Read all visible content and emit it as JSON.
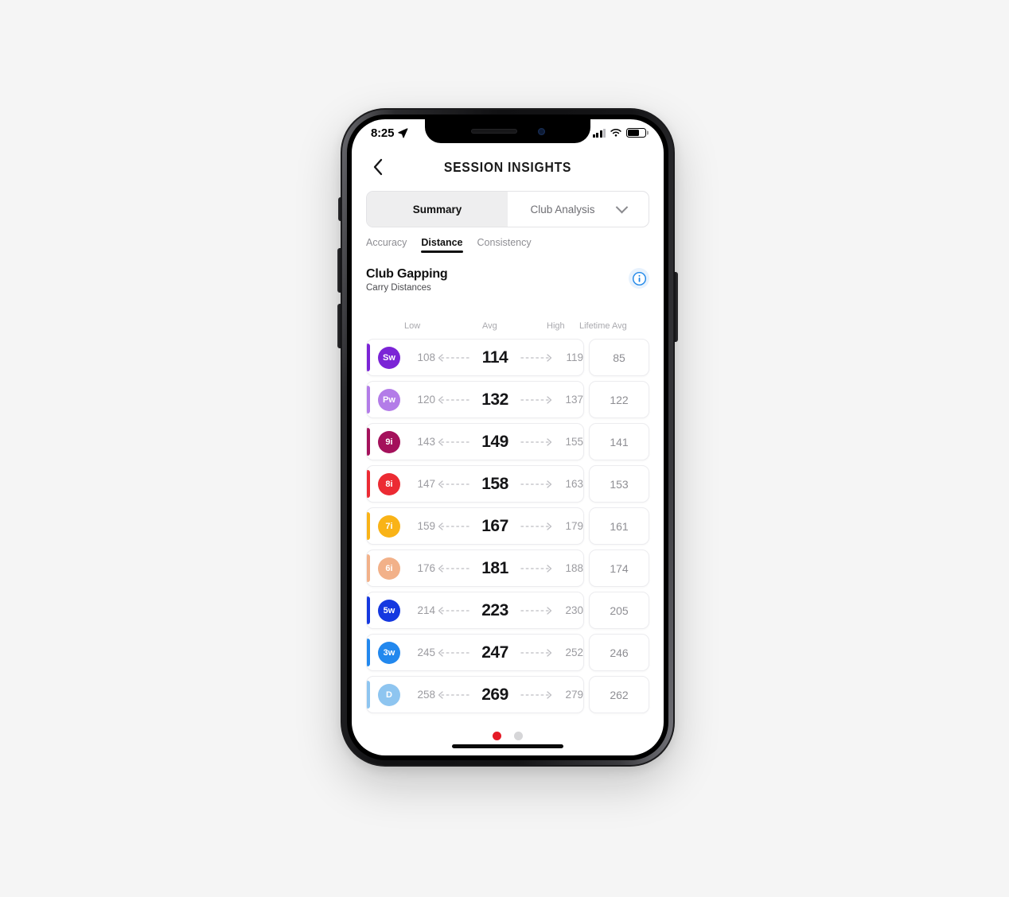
{
  "status_bar": {
    "time": "8:25",
    "location_icon": "location-arrow-icon",
    "signal_icon": "cellular-signal-icon",
    "wifi_icon": "wifi-icon",
    "battery_icon": "battery-icon"
  },
  "nav": {
    "back_icon": "chevron-left-icon",
    "title": "SESSION INSIGHTS"
  },
  "segmented_control": {
    "summary_label": "Summary",
    "club_analysis_label": "Club Analysis",
    "chevron_icon": "chevron-down-icon",
    "active": "Summary"
  },
  "sub_tabs": {
    "items": [
      {
        "label": "Accuracy",
        "active": false
      },
      {
        "label": "Distance",
        "active": true
      },
      {
        "label": "Consistency",
        "active": false
      }
    ]
  },
  "section": {
    "title": "Club Gapping",
    "subtitle": "Carry Distances",
    "info_icon": "info-circle-icon",
    "info_color": "#1f87e8"
  },
  "table": {
    "headers": {
      "low": "Low",
      "avg": "Avg",
      "high": "High",
      "lifetime": "Lifetime Avg"
    },
    "arrow_left_icon": "dashed-arrow-left-icon",
    "arrow_right_icon": "dashed-arrow-right-icon"
  },
  "pager": {
    "active_color": "#e51b27",
    "inactive_color": "#d6d6d8",
    "dots": 2,
    "active_index": 0
  },
  "home_indicator": "home-indicator-bar",
  "chart_data": {
    "type": "table",
    "title": "Club Gapping",
    "subtitle": "Carry Distances",
    "columns": [
      "Club",
      "Low",
      "Avg",
      "High",
      "Lifetime Avg"
    ],
    "unit": "yards",
    "rows": [
      {
        "club": "Sw",
        "low": "108",
        "avg": "114",
        "high": "119",
        "lifetime": "85",
        "color": "#7b24d6",
        "accent": "#7b24d6"
      },
      {
        "club": "Pw",
        "low": "120",
        "avg": "132",
        "high": "137",
        "lifetime": "122",
        "color": "#b37ce8",
        "accent": "#b37ce8"
      },
      {
        "club": "9i",
        "low": "143",
        "avg": "149",
        "high": "155",
        "lifetime": "141",
        "color": "#a4115b",
        "accent": "#a4115b"
      },
      {
        "club": "8i",
        "low": "147",
        "avg": "158",
        "high": "163",
        "lifetime": "153",
        "color": "#ec2b33",
        "accent": "#ec2b33"
      },
      {
        "club": "7i",
        "low": "159",
        "avg": "167",
        "high": "179",
        "lifetime": "161",
        "color": "#f9b317",
        "accent": "#f9b317"
      },
      {
        "club": "6i",
        "low": "176",
        "avg": "181",
        "high": "188",
        "lifetime": "174",
        "color": "#f2b189",
        "accent": "#f2b189"
      },
      {
        "club": "5w",
        "low": "214",
        "avg": "223",
        "high": "230",
        "lifetime": "205",
        "color": "#1538e0",
        "accent": "#1538e0"
      },
      {
        "club": "3w",
        "low": "245",
        "avg": "247",
        "high": "252",
        "lifetime": "246",
        "color": "#2288ee",
        "accent": "#2288ee"
      },
      {
        "club": "D",
        "low": "258",
        "avg": "269",
        "high": "279",
        "lifetime": "262",
        "color": "#8ec5f0",
        "accent": "#8ec5f0"
      }
    ]
  }
}
